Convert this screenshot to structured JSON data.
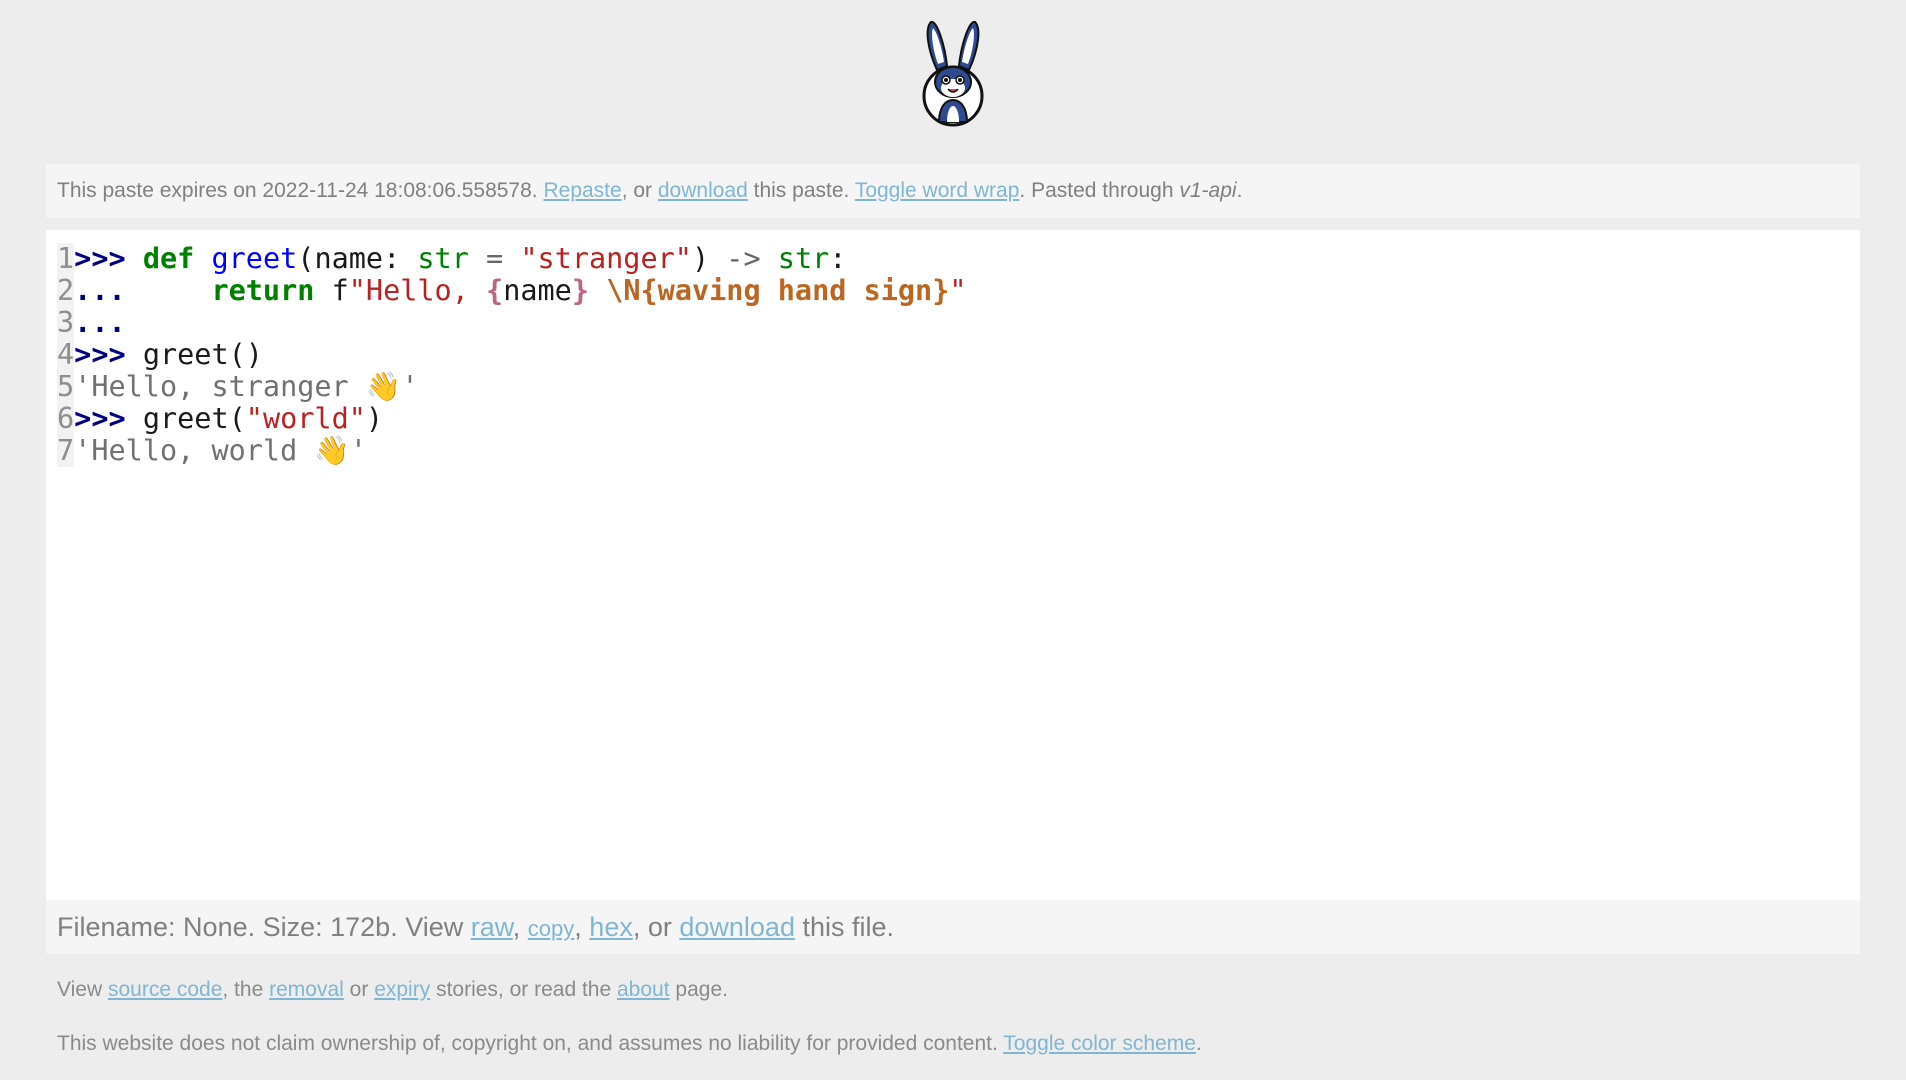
{
  "header": {
    "logo_name": "rabbit-mascot-logo"
  },
  "topbar": {
    "expires_prefix": "This paste expires on 2022-11-24 18:08:06.558578.",
    "repaste": "Repaste",
    "sep1": ", or",
    "download": "download",
    "this_paste": "this paste.",
    "toggle_wrap": "Toggle word wrap",
    "pasted_through": ". Pasted through",
    "source": "v1-api",
    "period": "."
  },
  "code": {
    "line_numbers": [
      "1",
      "2",
      "3",
      "4",
      "5",
      "6",
      "7"
    ],
    "lines": {
      "l1": {
        "prompt": ">>>",
        "kw": "def",
        "fn": "greet",
        "p1": "(name: ",
        "type1": "str",
        "eq": " = ",
        "default": "\"stranger\"",
        "p2": ") ",
        "arrow": "->",
        "type2": "str",
        "colon": ":"
      },
      "l2": {
        "prompt": "...",
        "kw": "return",
        "prefix": "f",
        "str_start": "\"Hello, ",
        "interp_open": "{",
        "var": "name",
        "interp_close": "}",
        "escape": "\\N{waving hand sign}",
        "str_end": "\""
      },
      "l3": {
        "prompt": "..."
      },
      "l4": {
        "prompt": ">>>",
        "call": "greet()"
      },
      "l5": {
        "out_start": "'Hello, stranger ",
        "emoji": "👋",
        "out_end": "'"
      },
      "l6": {
        "prompt": ">>>",
        "call": "greet(",
        "arg": "\"world\"",
        "close": ")"
      },
      "l7": {
        "out_start": "'Hello, world ",
        "emoji": "👋",
        "out_end": "'"
      }
    }
  },
  "bottombar": {
    "prefix": "Filename: None. Size: 172b. View",
    "raw": "raw",
    "copy": "copy",
    "hex": "hex",
    "or": ", or",
    "download": "download",
    "suffix": "this file."
  },
  "footer": {
    "view": "View",
    "source_code": "source code",
    "the": ", the",
    "removal": "removal",
    "or": "or",
    "expiry": "expiry",
    "stories": "stories, or read the",
    "about": "about",
    "page": "page.",
    "disclaimer": "This website does not claim ownership of, copyright on, and assumes no liability for provided content.",
    "toggle_color": "Toggle color scheme",
    "period": "."
  }
}
